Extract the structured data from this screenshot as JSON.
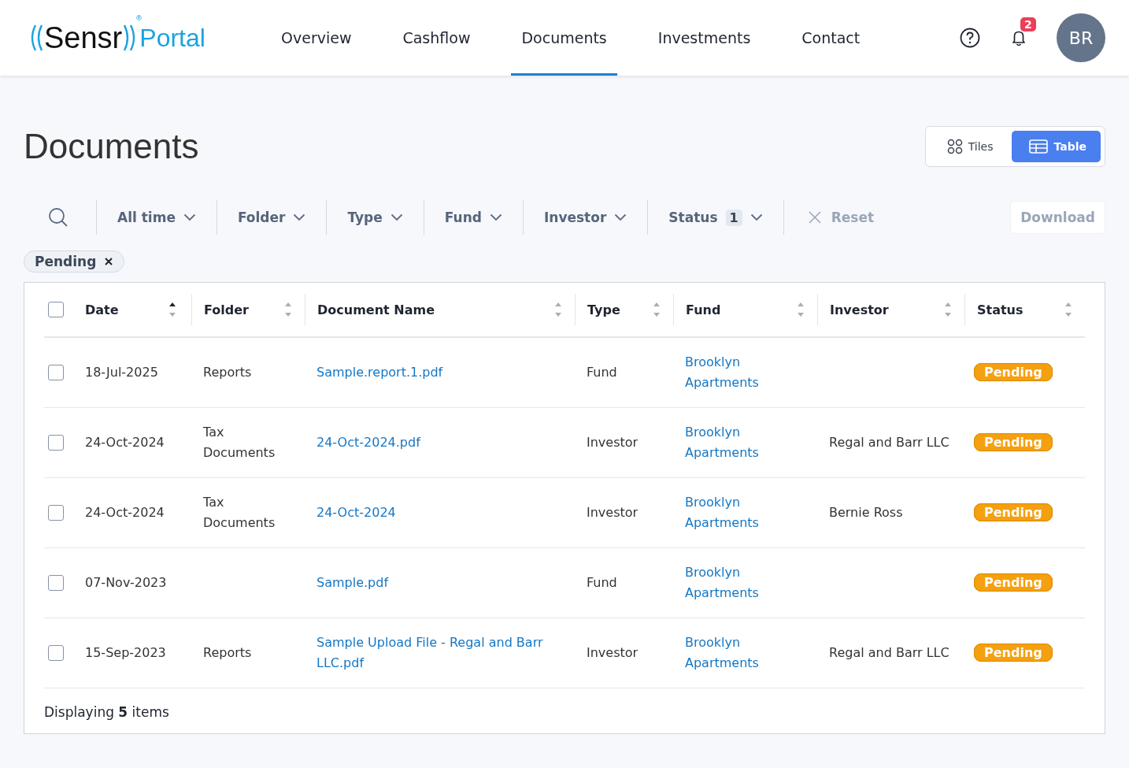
{
  "header": {
    "logo": {
      "name": "Sensr",
      "registered": "®",
      "product": "Portal"
    },
    "nav": [
      {
        "label": "Overview",
        "selected": false
      },
      {
        "label": "Cashflow",
        "selected": false
      },
      {
        "label": "Documents",
        "selected": true
      },
      {
        "label": "Investments",
        "selected": false
      },
      {
        "label": "Contact",
        "selected": false
      }
    ],
    "notifications": "2",
    "avatar": "BR"
  },
  "page": {
    "title": "Documents",
    "views": [
      {
        "label": "Tiles",
        "kind": "tiles",
        "selected": false
      },
      {
        "label": "Table",
        "kind": "table",
        "selected": true
      }
    ]
  },
  "filters": [
    {
      "label": "All time"
    },
    {
      "label": "Folder"
    },
    {
      "label": "Type"
    },
    {
      "label": "Fund"
    },
    {
      "label": "Investor"
    },
    {
      "label": "Status",
      "count": "1"
    }
  ],
  "reset": {
    "label": "Reset",
    "disabled": true
  },
  "download": {
    "label": "Download",
    "disabled": true
  },
  "chips": [
    {
      "label": "Pending"
    }
  ],
  "table": {
    "select_all": {
      "checked": false
    },
    "columns": [
      {
        "label": "Date",
        "sorted": true
      },
      {
        "label": "Folder",
        "sorted": false
      },
      {
        "label": "Document Name",
        "sorted": false
      },
      {
        "label": "Type",
        "sorted": false
      },
      {
        "label": "Fund",
        "sorted": false
      },
      {
        "label": "Investor",
        "sorted": false
      },
      {
        "label": "Status",
        "sorted": false
      }
    ],
    "rows": [
      {
        "checked": false,
        "date": "18-Jul-2025",
        "folder": "Reports",
        "document": "Sample.report.1.pdf",
        "type": "Fund",
        "fund": "Brooklyn Apartments",
        "status": "Pending"
      },
      {
        "checked": false,
        "date": "24-Oct-2024",
        "folder": "Tax Documents",
        "document": "24-Oct-2024.pdf",
        "type": "Investor",
        "fund": "Brooklyn Apartments",
        "investor": "Regal and Barr LLC",
        "status": "Pending"
      },
      {
        "checked": false,
        "date": "24-Oct-2024",
        "folder": "Tax Documents",
        "document": "24-Oct-2024",
        "type": "Investor",
        "fund": "Brooklyn Apartments",
        "investor": "Bernie Ross",
        "status": "Pending"
      },
      {
        "checked": false,
        "date": "07-Nov-2023",
        "document": "Sample.pdf",
        "type": "Fund",
        "fund": "Brooklyn Apartments",
        "status": "Pending"
      },
      {
        "checked": false,
        "date": "15-Sep-2023",
        "folder": "Reports",
        "document": "Sample Upload File - Regal and Barr LLC.pdf",
        "type": "Investor",
        "fund": "Brooklyn Apartments",
        "investor": "Regal and Barr LLC",
        "status": "Pending"
      }
    ],
    "footer": "Displaying **5** items"
  }
}
